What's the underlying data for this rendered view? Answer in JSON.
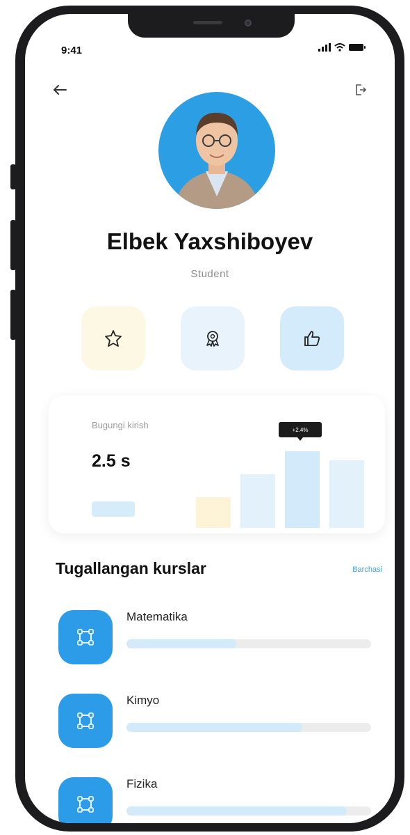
{
  "status_bar": {
    "time": "9:41"
  },
  "header": {
    "back_icon": "arrow-left-icon",
    "logout_icon": "logout-icon"
  },
  "profile": {
    "name": "Elbek Yaxshiboyev",
    "role": "Student"
  },
  "actions": [
    {
      "name": "star-badge",
      "icon": "star-badge-icon",
      "bg": "#fdf8e4",
      "color": "#222"
    },
    {
      "name": "award",
      "icon": "award-icon",
      "bg": "#e9f3fb",
      "color": "#222"
    },
    {
      "name": "like",
      "icon": "thumbs-up-icon",
      "bg": "#d4ebfb",
      "color": "#222"
    }
  ],
  "stats": {
    "label": "Bugungi kirish",
    "value": "2.5 s",
    "tooltip": "+2.4%",
    "bars": [
      {
        "level": 0.4,
        "color": "#fdf3d6"
      },
      {
        "level": 0.7,
        "color": "#e3f1fb"
      },
      {
        "level": 1.0,
        "color": "#d3eafa"
      },
      {
        "level": 0.88,
        "color": "#e3f1fb"
      }
    ]
  },
  "courses_section": {
    "title": "Tugallangan kurslar",
    "see_all": "Barchasi"
  },
  "courses": [
    {
      "name": "Matematika",
      "progress": 0.45
    },
    {
      "name": "Kimyo",
      "progress": 0.72
    },
    {
      "name": "Fizika",
      "progress": 0.9
    }
  ],
  "colors": {
    "accent": "#2d9ce8",
    "avatar_bg": "#2c9fe4"
  }
}
